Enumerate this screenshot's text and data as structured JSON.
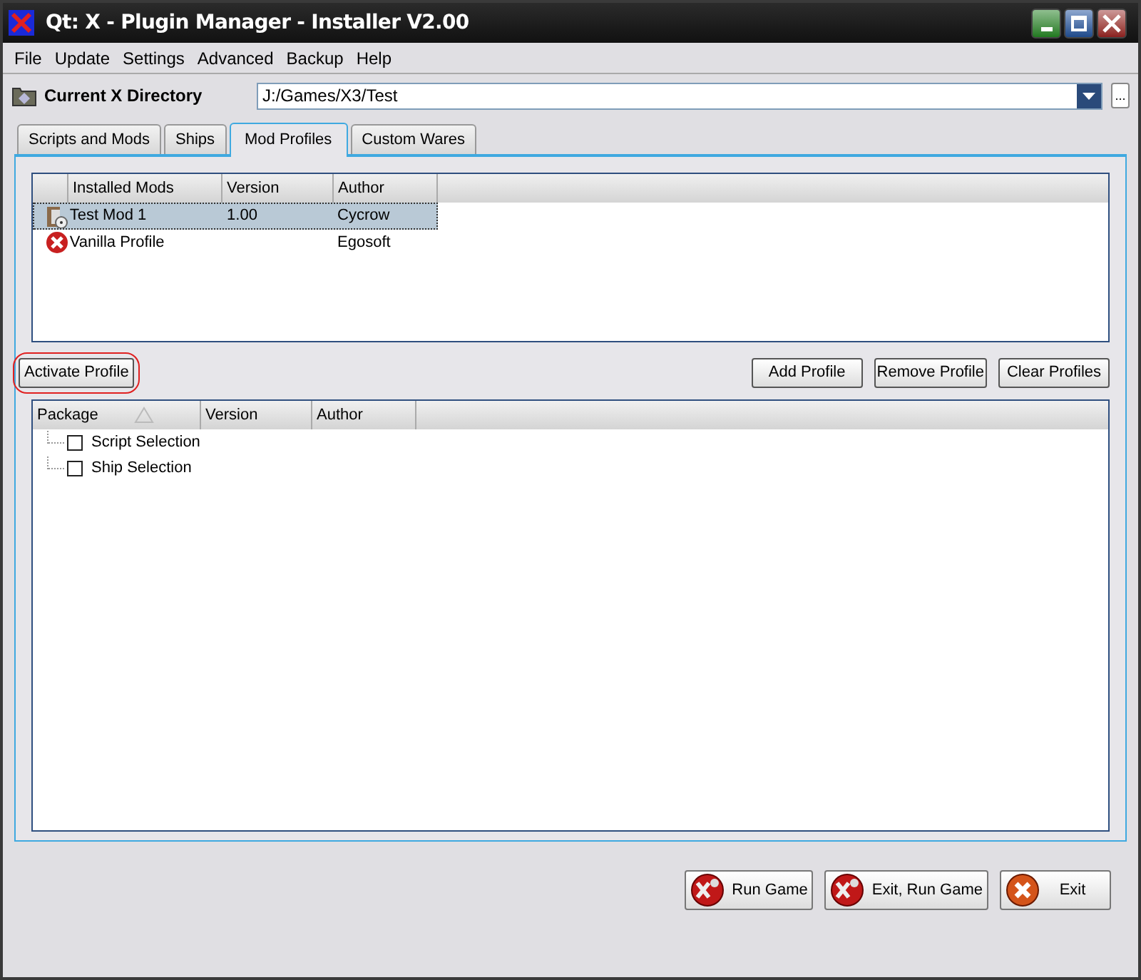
{
  "window": {
    "title": "Qt: X - Plugin Manager - Installer V2.00"
  },
  "menu": [
    "File",
    "Update",
    "Settings",
    "Advanced",
    "Backup",
    "Help"
  ],
  "directory": {
    "label": "Current X Directory",
    "value": "J:/Games/X3/Test",
    "browse": "..."
  },
  "tabs": [
    {
      "label": "Scripts and Mods",
      "selected": false
    },
    {
      "label": "Ships",
      "selected": false
    },
    {
      "label": "Mod Profiles",
      "selected": true
    },
    {
      "label": "Custom Wares",
      "selected": false
    }
  ],
  "profiles": {
    "columns": [
      "Installed Mods",
      "Version",
      "Author"
    ],
    "rows": [
      {
        "kind": "mod",
        "name": "Test Mod 1",
        "version": "1.00",
        "author": "Cycrow",
        "selected": true
      },
      {
        "kind": "vanilla",
        "name": "Vanilla Profile",
        "version": "",
        "author": "Egosoft",
        "selected": false
      }
    ]
  },
  "activate_button": {
    "label": "Activate Profile",
    "highlighted": true
  },
  "profile_buttons": [
    "Add Profile",
    "Remove Profile",
    "Clear Profiles"
  ],
  "packages": {
    "columns": [
      "Package",
      "Version",
      "Author"
    ],
    "rows": [
      {
        "name": "Script Selection",
        "checked": false
      },
      {
        "name": "Ship Selection",
        "checked": false
      }
    ]
  },
  "bottom_buttons": [
    {
      "kind": "run",
      "label": "Run Game"
    },
    {
      "kind": "run",
      "label": "Exit, Run Game"
    },
    {
      "kind": "exit",
      "label": "Exit"
    }
  ]
}
